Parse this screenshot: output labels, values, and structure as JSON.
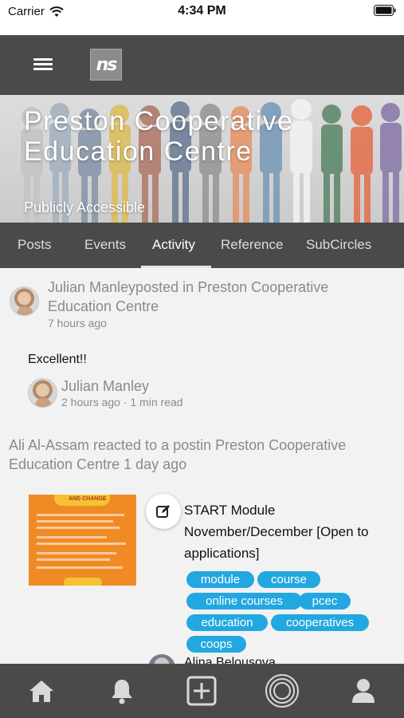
{
  "status_bar": {
    "carrier": "Carrier",
    "time": "4:34 PM"
  },
  "app_bar": {
    "logo_text": "ns"
  },
  "banner": {
    "title": "Preston Cooperative Education Centre",
    "subtitle": "Publicly Accessible"
  },
  "tabs": [
    {
      "label": "Posts"
    },
    {
      "label": "Events"
    },
    {
      "label": "Activity",
      "active": true
    },
    {
      "label": "Reference"
    },
    {
      "label": "SubCircles"
    }
  ],
  "activity1": {
    "line1": "Julian Manleyposted in Preston Cooperative",
    "line2": "Education Centre",
    "time": "7 hours ago"
  },
  "post": {
    "body": "Excellent!!",
    "author": "Julian Manley",
    "meta": "2 hours ago · 1 min read"
  },
  "activity2": {
    "line1": "Ali Al-Assam reacted to a postin Preston Cooperative",
    "line2": "Education Centre 1 day ago"
  },
  "module_post": {
    "title": "START Module November/December [Open to applications]",
    "thumb_banner": "AND CHANGE",
    "tags": [
      "module",
      "course",
      "online courses",
      "pcec",
      "education",
      "cooperatives",
      "coops"
    ]
  },
  "next_item": {
    "name": "Alina Belousova"
  },
  "bottom_nav": [
    {
      "icon": "home-icon"
    },
    {
      "icon": "bell-icon"
    },
    {
      "icon": "add-square-icon"
    },
    {
      "icon": "circles-icon"
    },
    {
      "icon": "profile-icon"
    }
  ],
  "colors": {
    "bar": "#4a4a4a",
    "tag": "#22a7e0",
    "thumb": "#f08a24"
  }
}
